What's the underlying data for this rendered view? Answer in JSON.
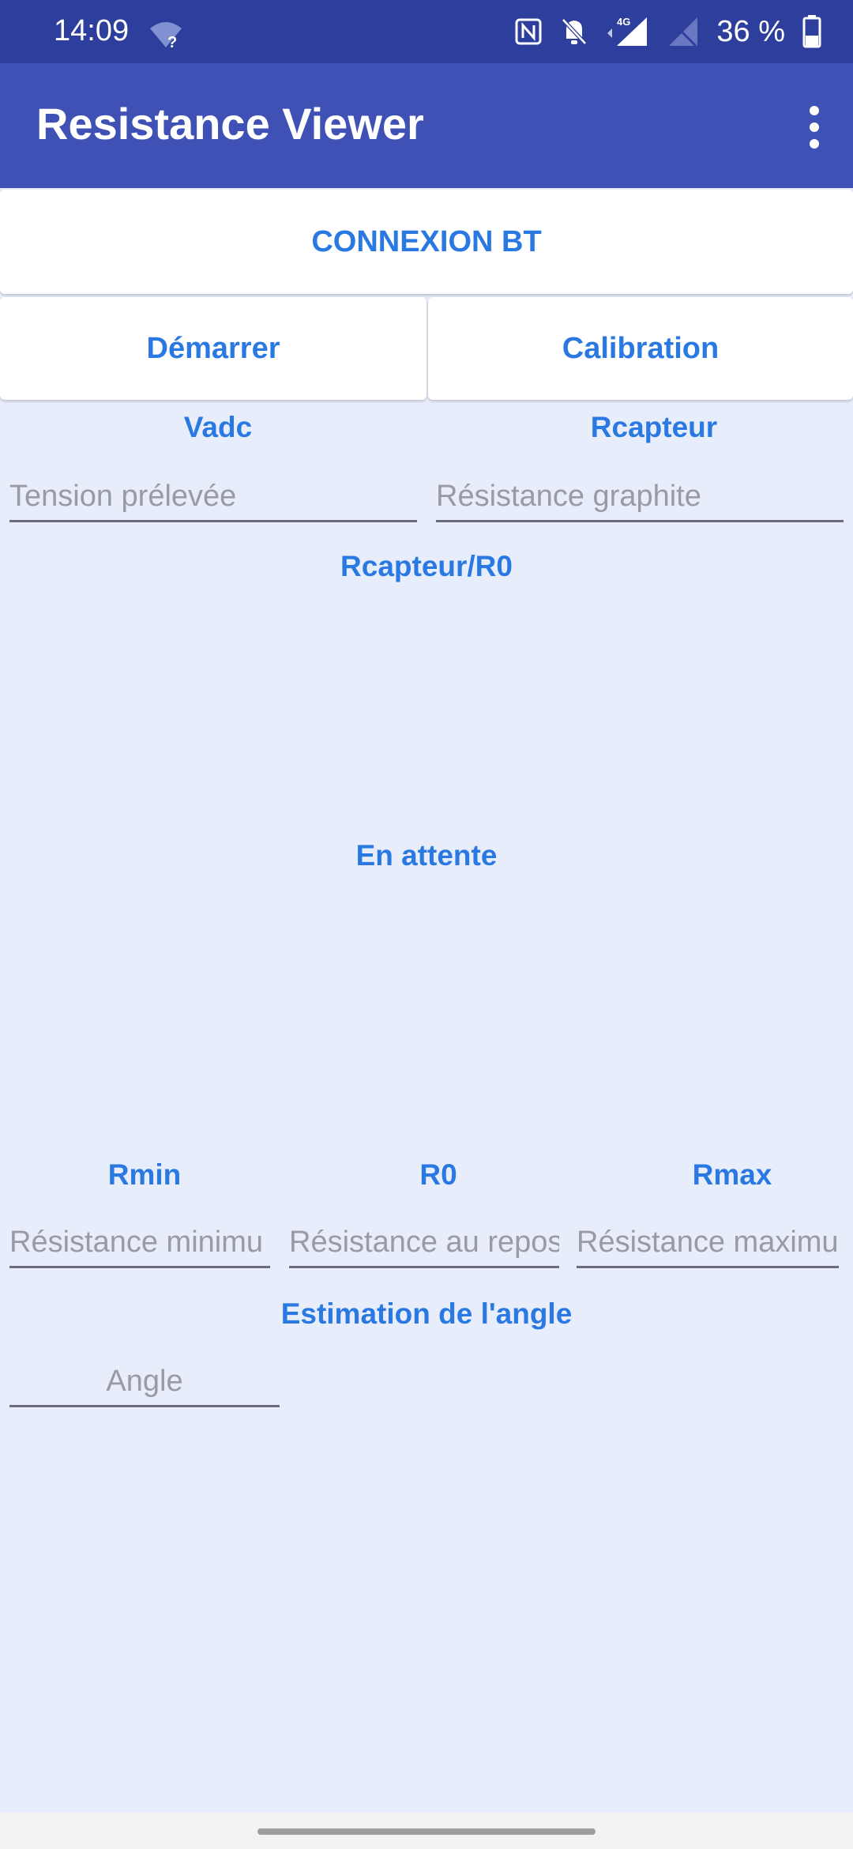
{
  "status_bar": {
    "time": "14:09",
    "battery": "36 %",
    "network": "4G",
    "icons": [
      "wifi-question-icon",
      "nfc-icon",
      "bell-off-icon",
      "signal-4g-icon",
      "signal-empty-icon",
      "battery-icon"
    ]
  },
  "app_bar": {
    "title": "Resistance Viewer",
    "menu_icon": "more-vert-icon"
  },
  "buttons": {
    "connect": "CONNEXION BT",
    "start": "Démarrer",
    "calibrate": "Calibration"
  },
  "measurements": {
    "vadc_label": "Vadc",
    "vadc_placeholder": "Tension prélevée",
    "rcapteur_label": "Rcapteur",
    "rcapteur_placeholder": "Résistance graphite",
    "ratio_label": "Rcapteur/R0",
    "status": "En attente"
  },
  "calibration": {
    "rmin_label": "Rmin",
    "rmin_placeholder": "Résistance minimu",
    "r0_label": "R0",
    "r0_placeholder": "Résistance au repos",
    "rmax_label": "Rmax",
    "rmax_placeholder": "Résistance maximu"
  },
  "angle": {
    "label": "Estimation de l'angle",
    "placeholder": "Angle"
  },
  "colors": {
    "status_bar": "#2d3e9c",
    "app_bar": "#3f51b5",
    "accent": "#2a79e3",
    "background": "#e8edfb"
  }
}
